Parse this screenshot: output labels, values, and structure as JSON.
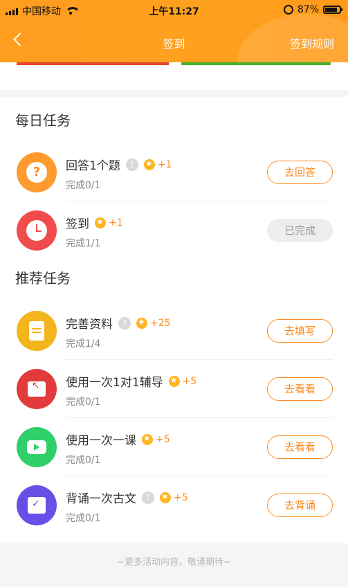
{
  "status_bar": {
    "carrier": "中国移动",
    "time": "上午11:27",
    "battery_text": "87%",
    "battery_level": 0.87
  },
  "nav": {
    "title": "签到",
    "rule_label": "签到规则"
  },
  "sections": {
    "daily": "每日任务",
    "recommended": "推荐任务"
  },
  "tasks": [
    {
      "name": "回答1个题",
      "has_help": true,
      "reward": "+1",
      "progress": "完成0/1",
      "button": "去回答",
      "done": false,
      "icon": "question-bubble-icon"
    },
    {
      "name": "签到",
      "has_help": false,
      "reward": "+1",
      "progress": "完成1/1",
      "button": "已完成",
      "done": true,
      "icon": "clock-icon"
    },
    {
      "name": "完善资料",
      "has_help": true,
      "reward": "+25",
      "progress": "完成1/4",
      "button": "去填写",
      "done": false,
      "icon": "document-icon"
    },
    {
      "name": "使用一次1对1辅导",
      "has_help": false,
      "reward": "+5",
      "progress": "完成0/1",
      "button": "去看看",
      "done": false,
      "icon": "tutoring-board-icon"
    },
    {
      "name": "使用一次一课",
      "has_help": false,
      "reward": "+5",
      "progress": "完成0/1",
      "button": "去看看",
      "done": false,
      "icon": "video-camera-icon"
    },
    {
      "name": "背诵一次古文",
      "has_help": true,
      "reward": "+5",
      "progress": "完成0/1",
      "button": "去背诵",
      "done": false,
      "icon": "book-check-icon"
    }
  ],
  "help_symbol": "?",
  "footer": "~更多活动内容，敬请期待~",
  "colors": {
    "header": "#ffa11f",
    "accent": "#ff8a1c",
    "icon_question": "#ff9a2e",
    "icon_clock": "#f14b4b",
    "icon_doc": "#f2b51c",
    "icon_board": "#e33b3b",
    "icon_cam": "#2fcf6a",
    "icon_book": "#6a4ee8"
  }
}
